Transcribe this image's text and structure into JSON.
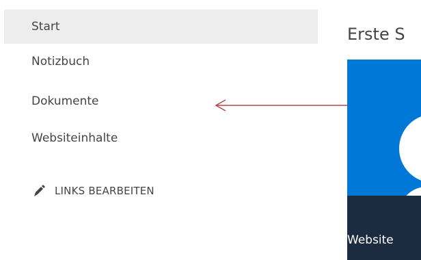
{
  "nav": {
    "items": [
      {
        "label": "Start",
        "selected": true
      },
      {
        "label": "Notizbuch",
        "selected": false
      },
      {
        "label": "Dokumente",
        "selected": false
      },
      {
        "label": "Websiteinhalte",
        "selected": false
      }
    ],
    "edit_links_label": "LINKS BEARBEITEN",
    "edit_icon": "pencil-icon"
  },
  "main": {
    "title": "Erste S",
    "tile": {
      "label": "Website",
      "icon": "sharepoint-icon",
      "color": "#0078d7",
      "footer_color": "#1c2b40"
    }
  },
  "annotation": {
    "arrow_color": "#b34747",
    "direction": "left"
  }
}
